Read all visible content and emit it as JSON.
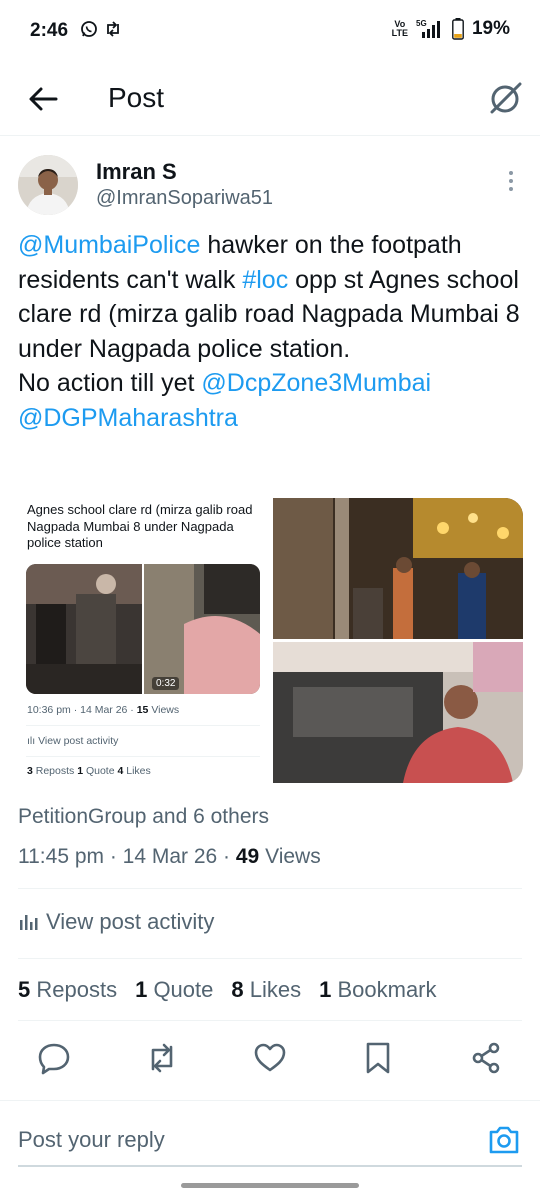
{
  "status_bar": {
    "time": "2:46",
    "network_top": "Vo",
    "network_bottom": "LTE",
    "signal_label": "5G",
    "battery": "19%"
  },
  "header": {
    "title": "Post"
  },
  "author": {
    "name": "Imran S",
    "handle": "@ImranSopariwa51"
  },
  "tweet": {
    "mention1": "@MumbaiPolice",
    "text1": " hawker on the footpath residents can't walk ",
    "hashtag": "#loc",
    "text2": " opp st Agnes school clare rd (mirza galib road Nagpada Mumbai 8 under Nagpada police station.",
    "text3": "No action till yet ",
    "mention2": "@DcpZone3Mumbai",
    "mention3": "@DGPMaharashtra"
  },
  "media": {
    "screenshot_text": "Agnes school clare rd (mirza galib road Nagpada Mumbai 8 under Nagpada police station",
    "video_duration": "0:32",
    "shot_time": "10:36 pm · 14 Mar 26 · ",
    "shot_views_count": "15",
    "shot_views_label": " Views",
    "shot_activity": "View post activity",
    "shot_reposts_count": "3",
    "shot_reposts_label": " Reposts ",
    "shot_quote_count": "1",
    "shot_quote_label": " Quote ",
    "shot_likes_count": "4",
    "shot_likes_label": " Likes"
  },
  "liked_by": "PetitionGroup and 6 others",
  "meta": {
    "time": "11:45 pm · 14 Mar 26 · ",
    "views_count": "49",
    "views_label": " Views"
  },
  "activity_label": "View post activity",
  "stats": {
    "reposts_count": "5",
    "reposts_label": " Reposts",
    "quote_count": "1",
    "quote_label": " Quote",
    "likes_count": "8",
    "likes_label": " Likes",
    "bookmark_count": "1",
    "bookmark_label": " Bookmark"
  },
  "actions": [
    "reply-icon",
    "repost-icon",
    "like-icon",
    "bookmark-icon",
    "share-icon"
  ],
  "reply": {
    "placeholder": "Post your reply"
  },
  "colors": {
    "accent": "#1d9bf0",
    "text": "#0f1419",
    "secondary": "#536471"
  }
}
